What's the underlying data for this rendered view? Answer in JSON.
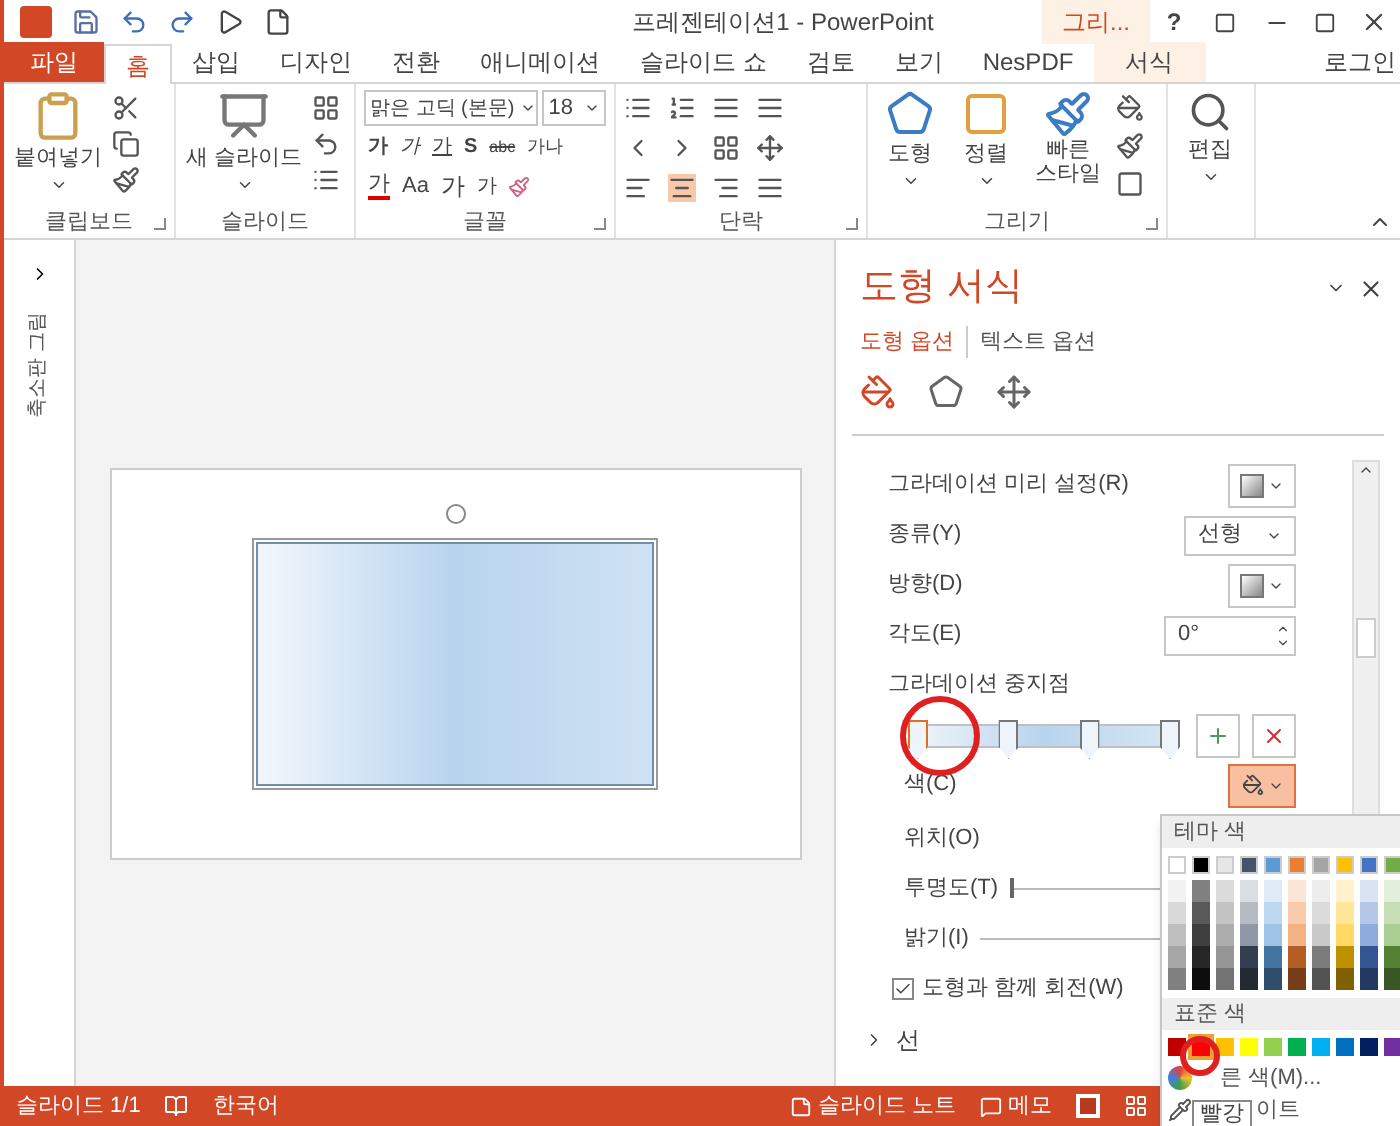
{
  "title_bar": {
    "title": "프레젠테이션1 - PowerPoint",
    "context_label": "그리...",
    "help": "?"
  },
  "tabs": [
    {
      "label": "파일",
      "kind": "file",
      "selected": false
    },
    {
      "label": "홈",
      "kind": "normal",
      "selected": true
    },
    {
      "label": "삽입",
      "kind": "normal",
      "selected": false
    },
    {
      "label": "디자인",
      "kind": "normal",
      "selected": false
    },
    {
      "label": "전환",
      "kind": "normal",
      "selected": false
    },
    {
      "label": "애니메이션",
      "kind": "normal",
      "selected": false
    },
    {
      "label": "슬라이드 쇼",
      "kind": "normal",
      "selected": false
    },
    {
      "label": "검토",
      "kind": "normal",
      "selected": false
    },
    {
      "label": "보기",
      "kind": "normal",
      "selected": false
    },
    {
      "label": "NesPDF",
      "kind": "normal",
      "selected": false
    },
    {
      "label": "서식",
      "kind": "context",
      "selected": false
    }
  ],
  "login": "로그인",
  "ribbon": {
    "clipboard": {
      "label": "클립보드",
      "paste": "붙여넣기"
    },
    "slides": {
      "label": "슬라이드",
      "new_slide": "새 슬라이드"
    },
    "font": {
      "label": "글꼴",
      "font_name": "맑은 고딕 (본문)",
      "font_size": "18",
      "row1": [
        "가",
        "가",
        "가",
        "S",
        "abc",
        "가나"
      ],
      "font_color": "가",
      "case": "Aa",
      "grow": "가",
      "shrink": "가"
    },
    "paragraph": {
      "label": "단락"
    },
    "drawing": {
      "label": "그리기",
      "shapes": "도형",
      "arrange": "정렬",
      "quick_styles": "빠른\n스타일"
    },
    "editing": {
      "label": "편집"
    }
  },
  "thumbnails_label": "축소판 그림",
  "pane": {
    "title": "도형 서식",
    "tabs": [
      {
        "label": "도형 옵션",
        "selected": true
      },
      {
        "label": "텍스트 옵션",
        "selected": false
      }
    ],
    "icon_tabs": [
      {
        "kind": "fill",
        "selected": true
      },
      {
        "kind": "effects",
        "selected": false
      },
      {
        "kind": "size",
        "selected": false
      }
    ],
    "rows": [
      {
        "kind": "swatch",
        "label": "그라데이션 미리 설정(R)"
      },
      {
        "kind": "dropdown",
        "label": "종류(Y)",
        "value": "선형"
      },
      {
        "kind": "swatch",
        "label": "방향(D)"
      },
      {
        "kind": "spinner",
        "label": "각도(E)",
        "value": "0°"
      },
      {
        "kind": "stops",
        "label": "그라데이션 중지점",
        "stops": [
          {
            "level": 0,
            "selected": true
          },
          {
            "level": 0.36,
            "selected": false
          },
          {
            "level": 0.68,
            "selected": false
          },
          {
            "level": 1,
            "selected": false
          }
        ]
      },
      {
        "kind": "color",
        "label": "색(C)"
      },
      {
        "kind": "plain",
        "label": "위치(O)"
      },
      {
        "kind": "slider",
        "label": "투명도(T)",
        "level": 0
      },
      {
        "kind": "line",
        "label": "밝기(I)"
      },
      {
        "kind": "checkbox",
        "label": "도형과 함께 회전(W)",
        "checked": true
      }
    ],
    "section": {
      "label": "선",
      "expanded": false
    }
  },
  "palette": {
    "theme_title": "테마 색",
    "theme": [
      {
        "color": "#ffffff"
      },
      {
        "color": "#000000"
      },
      {
        "color": "#e7e6e6"
      },
      {
        "color": "#44546a"
      },
      {
        "color": "#5b9bd5"
      },
      {
        "color": "#ed7d31"
      },
      {
        "color": "#a5a5a5"
      },
      {
        "color": "#ffc000"
      },
      {
        "color": "#4472c4"
      },
      {
        "color": "#70ad47"
      }
    ],
    "standard_title": "표준 색",
    "standard": [
      {
        "color": "#c00000",
        "selected": false
      },
      {
        "color": "#ff0000",
        "selected": true
      },
      {
        "color": "#ffc000",
        "selected": false
      },
      {
        "color": "#ffff00",
        "selected": false
      },
      {
        "color": "#92d050",
        "selected": false
      },
      {
        "color": "#00b050",
        "selected": false
      },
      {
        "color": "#00b0f0",
        "selected": false
      },
      {
        "color": "#0070c0",
        "selected": false
      },
      {
        "color": "#002060",
        "selected": false
      },
      {
        "color": "#7030a0",
        "selected": false
      }
    ],
    "more_colors": "른 색(M)...",
    "eyedropper": "이트",
    "tooltip": "빨강"
  },
  "status_bar": {
    "slide": "슬라이드 1/1",
    "language": "한국어",
    "notes": "슬라이드 노트",
    "comments": "메모"
  }
}
